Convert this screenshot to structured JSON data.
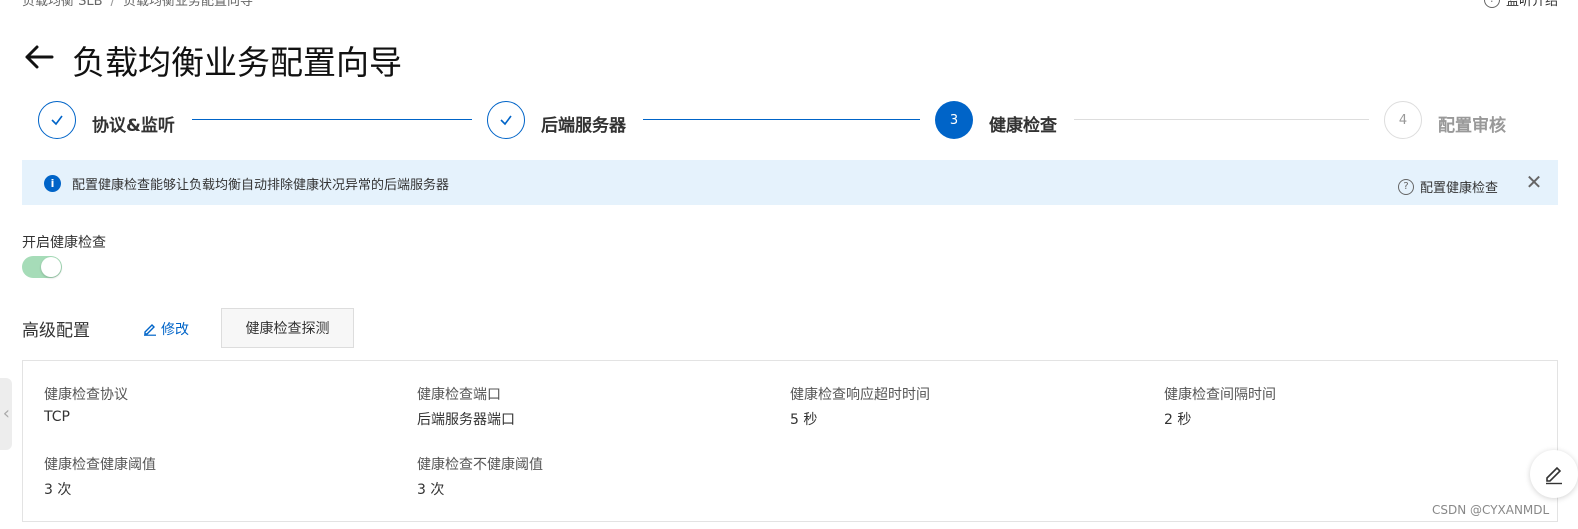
{
  "breadcrumb": {
    "root": "负载均衡 SLB",
    "separator": "/",
    "current": "负载均衡业务配置向导"
  },
  "top_help": {
    "label": "监听介绍",
    "icon": "question-circle-icon"
  },
  "page": {
    "title": "负载均衡业务配置向导",
    "back_icon": "arrow-left-icon"
  },
  "steps": [
    {
      "label": "协议&监听",
      "status": "done",
      "icon": "check-icon"
    },
    {
      "label": "后端服务器",
      "status": "done",
      "icon": "check-icon"
    },
    {
      "number": "3",
      "label": "健康检查",
      "status": "active"
    },
    {
      "number": "4",
      "label": "配置审核",
      "status": "todo"
    }
  ],
  "notice": {
    "text": "配置健康检查能够让负载均衡自动排除健康状况异常的后端服务器",
    "help_label": "配置健康检查",
    "close_symbol": "✕",
    "info_symbol": "i"
  },
  "health_check": {
    "toggle_label": "开启健康检查",
    "enabled": true
  },
  "advanced": {
    "title": "高级配置",
    "edit_label": "修改",
    "probe_button": "健康检查探测",
    "fields": [
      {
        "label": "健康检查协议",
        "value": "TCP"
      },
      {
        "label": "健康检查端口",
        "value": "后端服务器端口"
      },
      {
        "label": "健康检查响应超时时间",
        "value": "5 秒"
      },
      {
        "label": "健康检查间隔时间",
        "value": "2 秒"
      },
      {
        "label": "健康检查健康阈值",
        "value": "3 次"
      },
      {
        "label": "健康检查不健康阈值",
        "value": "3 次"
      }
    ]
  },
  "side_tab": {
    "symbol": "‹"
  },
  "watermark": "CSDN @CYXANMDL",
  "colors": {
    "primary": "#0064c8",
    "notice_bg": "#e5f2fc",
    "toggle_on": "#a6dcb8",
    "border": "#e3e3e3"
  }
}
